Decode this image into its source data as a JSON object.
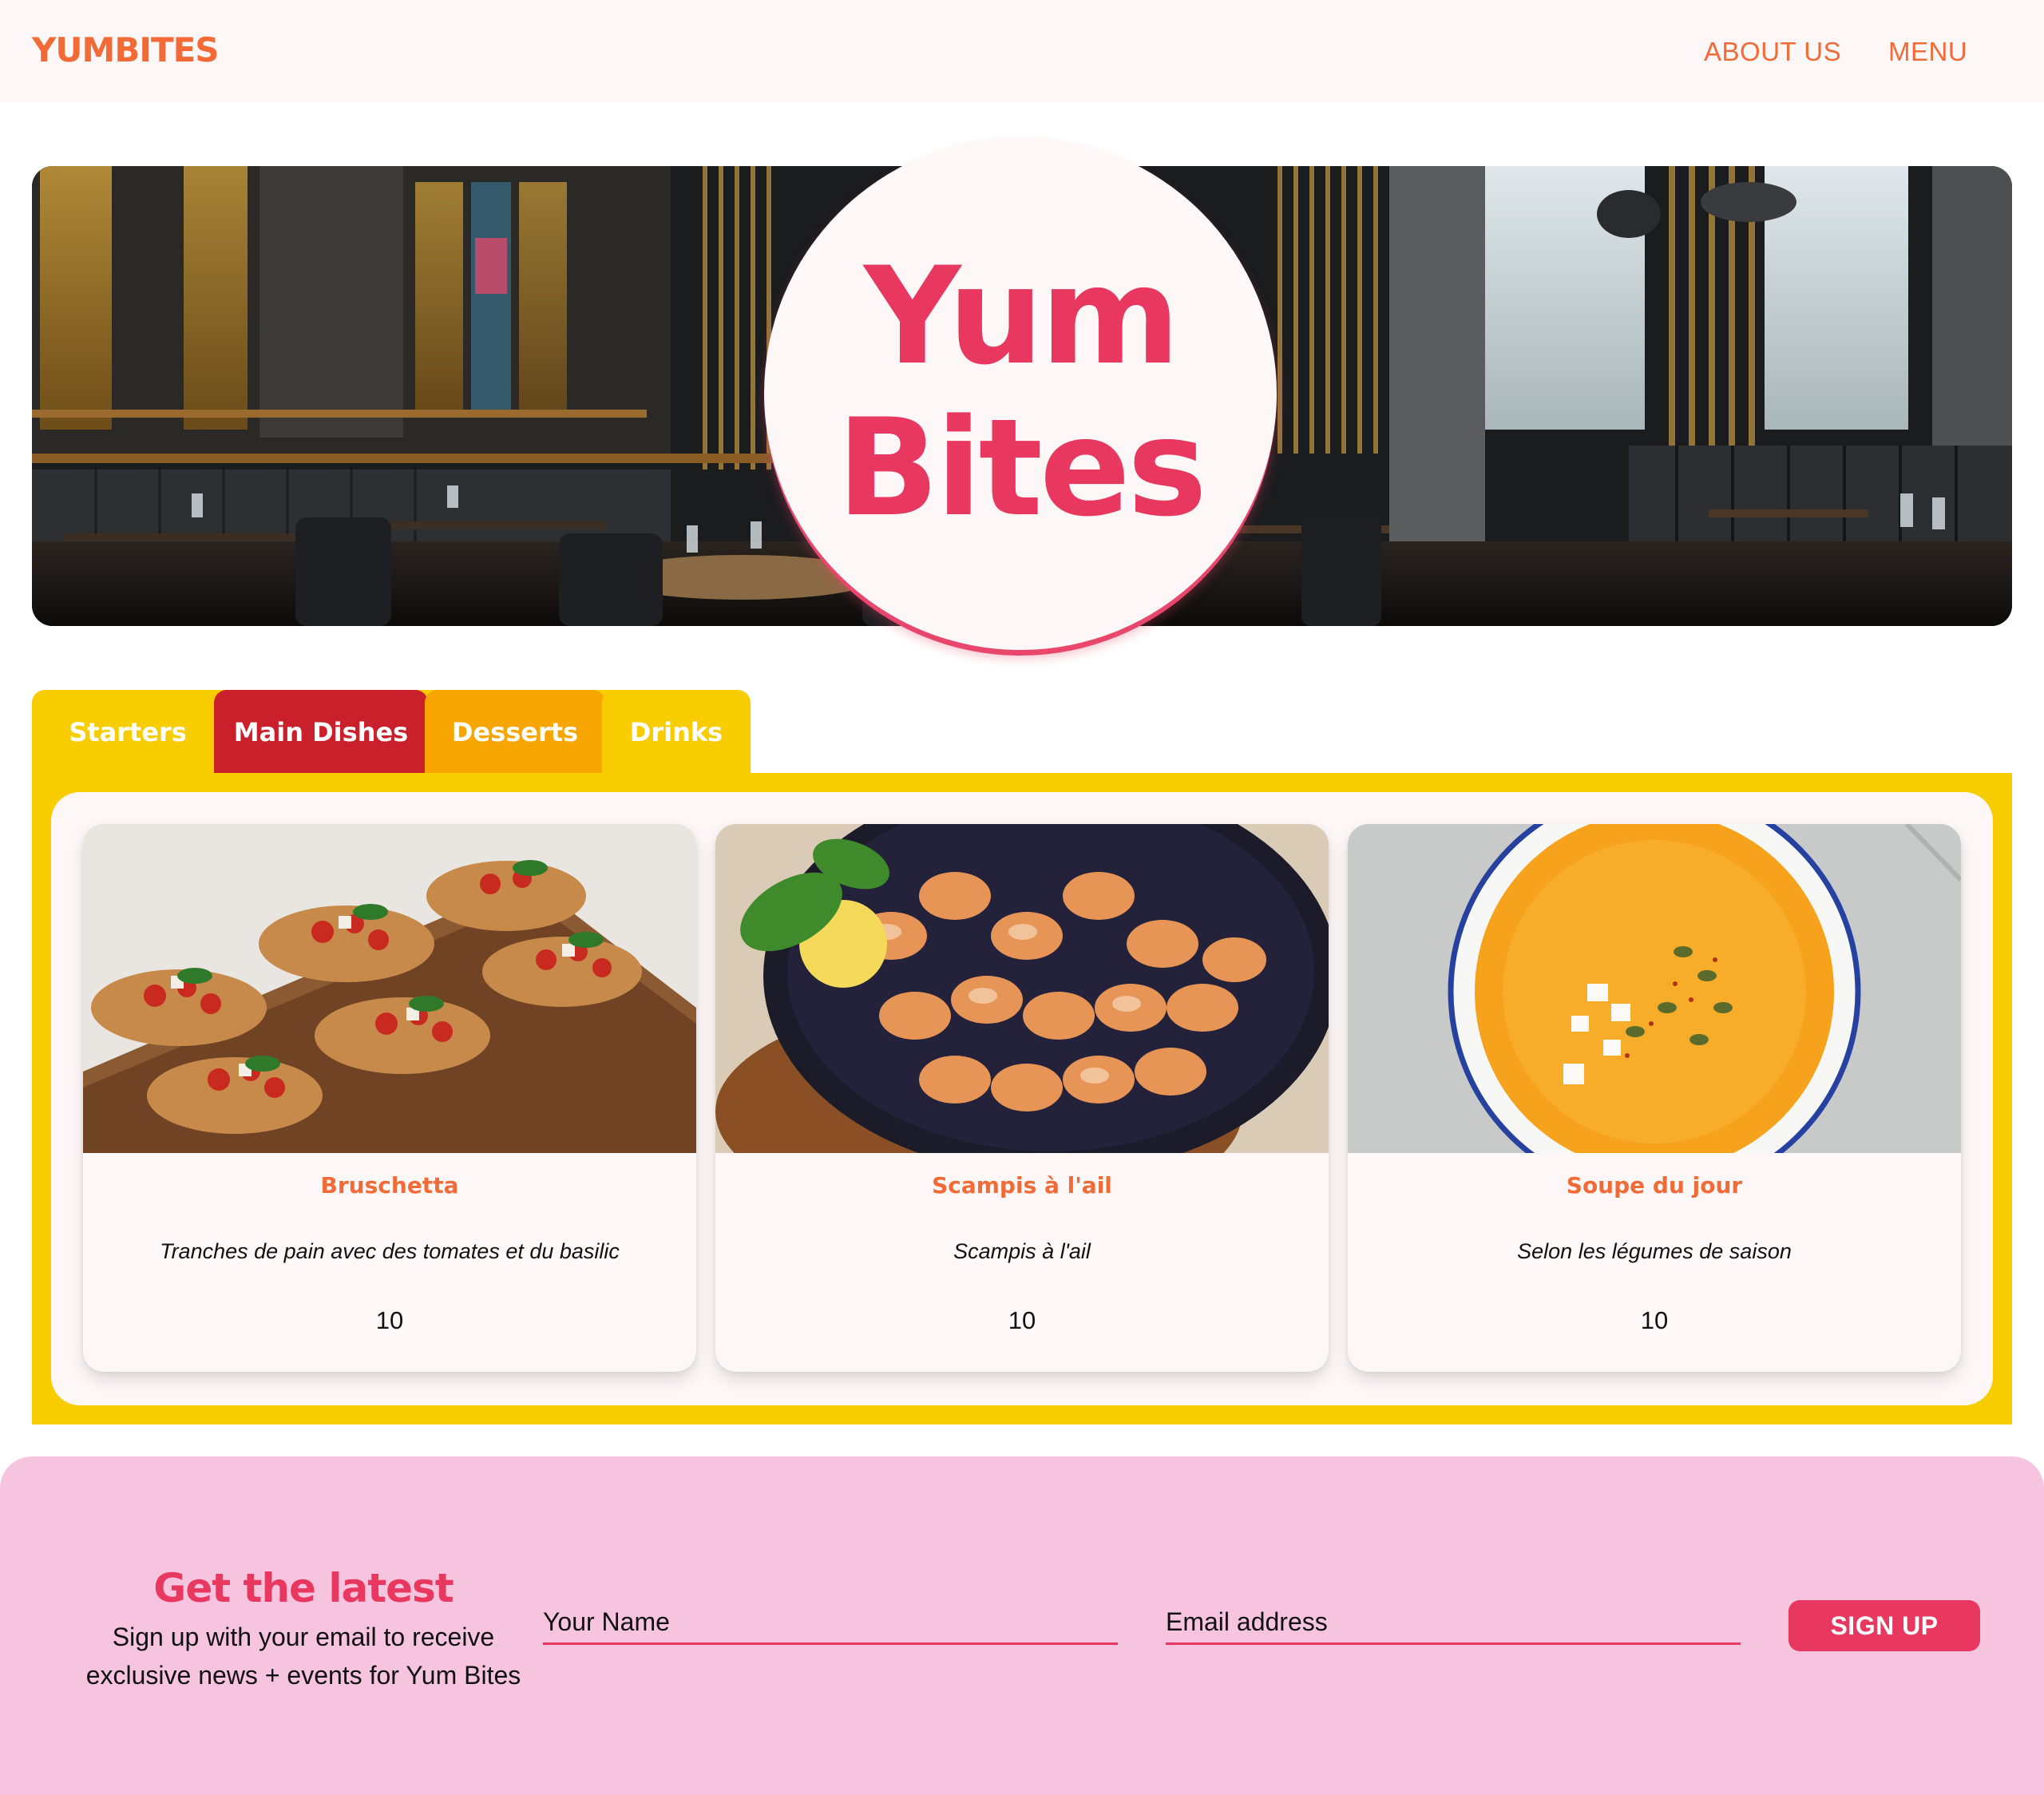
{
  "header": {
    "brand": "YUMBITES",
    "nav": [
      {
        "label": "ABOUT US"
      },
      {
        "label": "MENU"
      }
    ]
  },
  "hero": {
    "title_line1": "Yum",
    "title_line2": "Bites"
  },
  "menu": {
    "tabs": [
      {
        "label": "Starters"
      },
      {
        "label": "Main Dishes"
      },
      {
        "label": "Desserts"
      },
      {
        "label": "Drinks"
      }
    ],
    "items": [
      {
        "name": "Bruschetta",
        "description": "Tranches de pain avec des tomates et du basilic",
        "price": "10"
      },
      {
        "name": "Scampis à l'ail",
        "description": "Scampis à l'ail",
        "price": "10"
      },
      {
        "name": "Soupe du jour",
        "description": "Selon les légumes de saison",
        "price": "10"
      }
    ]
  },
  "newsletter": {
    "title": "Get the latest",
    "text_line1": "Sign up with your email to receive",
    "text_line2": "exclusive news + events for Yum Bites",
    "name_placeholder": "Your Name",
    "email_placeholder": "Email address",
    "button_label": "SIGN UP"
  },
  "colors": {
    "accent_orange": "#f26a36",
    "brand_pink": "#e8385f",
    "menu_yellow": "#f7cd00",
    "tab_red": "#c9202c",
    "tab_orange": "#f7a500",
    "newsletter_bg": "#f7c4e0",
    "page_bg": "#fdf7f8"
  }
}
